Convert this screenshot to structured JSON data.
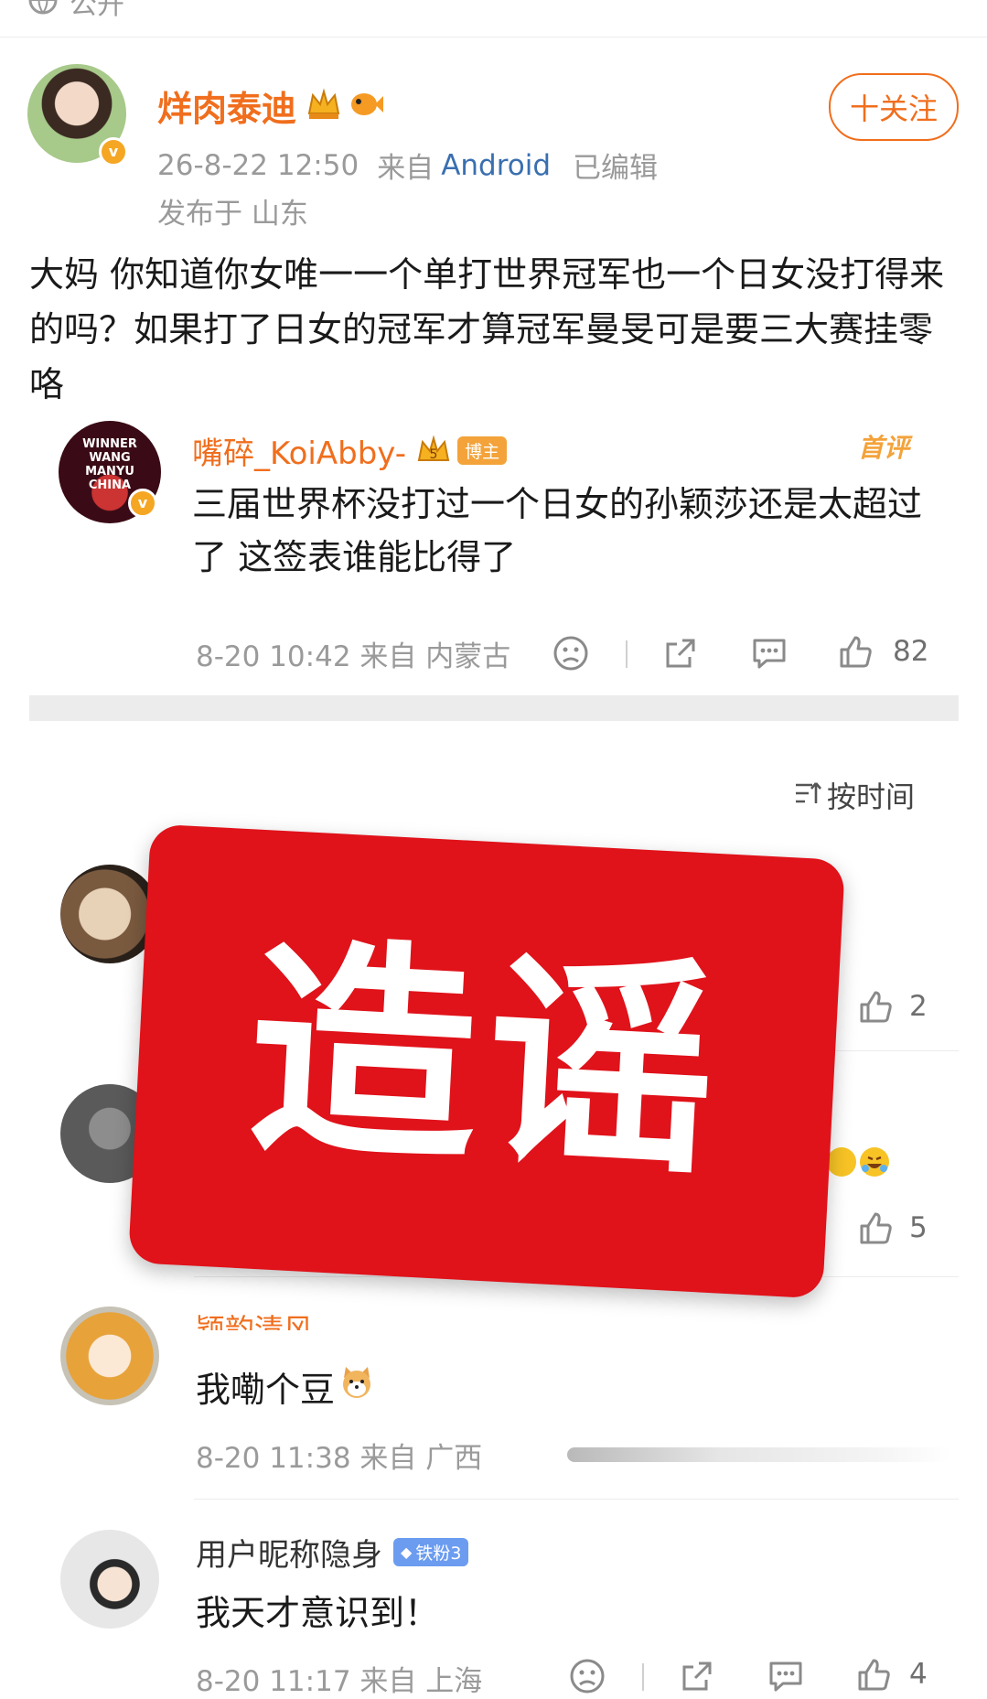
{
  "top_bar": {
    "label": "公开"
  },
  "post": {
    "author": "烊肉泰迪",
    "date": "26-8-22 12:50",
    "source_prefix": "来自",
    "source_device": "Android",
    "edited": "已编辑",
    "location": "发布于 山东",
    "follow_label": "十关注",
    "text": "大妈 你知道你女唯一一个单打世界冠军也一个日女没打得来的吗？如果打了日女的冠军才算冠军曼旻可是要三大赛挂零咯"
  },
  "quoted": {
    "user": "嘴碎_KoiAbby-",
    "badge": "博主",
    "badge_level": "5",
    "tag": "首评",
    "avatar_text": "WINNER WANG MANYU CHINA",
    "text": "三届世界杯没打过一个日女的孙颖莎还是太超过了 这签表谁能比得了",
    "meta": "8-20 10:42 来自 内蒙古",
    "likes": "82"
  },
  "sort_label": "按时间",
  "overlay": {
    "text": "造谣"
  },
  "comments": [
    {
      "likes": "2"
    },
    {
      "likes": "5"
    },
    {
      "user_partial": "颖韵清风",
      "text": "我嘞个豆",
      "meta": "8-20 11:38 来自 广西"
    },
    {
      "user": "用户昵称隐身",
      "badge": "铁粉3",
      "text": "我天才意识到！",
      "meta": "8-20 11:17 来自 上海",
      "likes": "4"
    }
  ],
  "colors": {
    "accent": "#f06e1d",
    "link_blue": "#3a6fb0",
    "stamp_red": "#e0121a",
    "iron_fan_blue": "#6b9cf0"
  }
}
